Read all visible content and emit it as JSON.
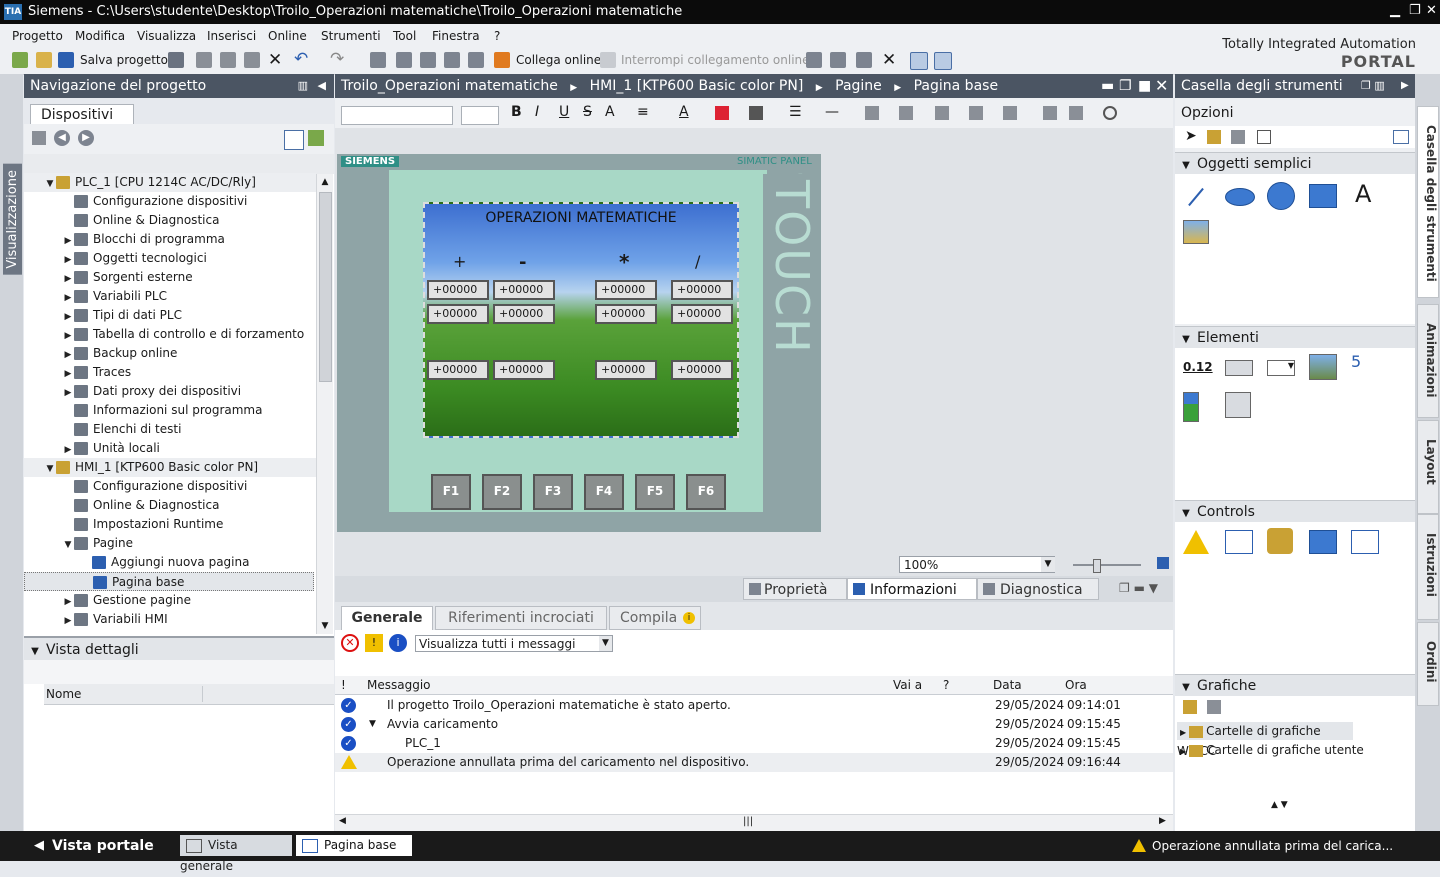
{
  "window": {
    "app": "Siemens",
    "path": "C:\\Users\\studente\\Desktop\\Troilo_Operazioni matematiche\\Troilo_Operazioni matematiche"
  },
  "menu": [
    "Progetto",
    "Modifica",
    "Visualizza",
    "Inserisci",
    "Online",
    "Strumenti",
    "Tool",
    "Finestra",
    "?"
  ],
  "toolbar": {
    "save": "Salva progetto",
    "connect": "Collega online",
    "disconnect": "Interrompi collegamento online"
  },
  "brand": {
    "line1": "Totally Integrated Automation",
    "line2": "PORTAL"
  },
  "left": {
    "title": "Navigazione del progetto",
    "tab": "Dispositivi",
    "strip": "Visualizzazione",
    "tree": [
      {
        "label": "PLC_1 [CPU 1214C AC/DC/Rly]",
        "arrow": "▼",
        "level": 0
      },
      {
        "label": "Configurazione dispositivi",
        "arrow": "",
        "level": 1
      },
      {
        "label": "Online & Diagnostica",
        "arrow": "",
        "level": 1
      },
      {
        "label": "Blocchi di programma",
        "arrow": "▶",
        "level": 1
      },
      {
        "label": "Oggetti tecnologici",
        "arrow": "▶",
        "level": 1
      },
      {
        "label": "Sorgenti esterne",
        "arrow": "▶",
        "level": 1
      },
      {
        "label": "Variabili PLC",
        "arrow": "▶",
        "level": 1
      },
      {
        "label": "Tipi di dati PLC",
        "arrow": "▶",
        "level": 1
      },
      {
        "label": "Tabella di controllo e di forzamento",
        "arrow": "▶",
        "level": 1
      },
      {
        "label": "Backup online",
        "arrow": "▶",
        "level": 1
      },
      {
        "label": "Traces",
        "arrow": "▶",
        "level": 1
      },
      {
        "label": "Dati proxy dei dispositivi",
        "arrow": "▶",
        "level": 1
      },
      {
        "label": "Informazioni sul programma",
        "arrow": "",
        "level": 1
      },
      {
        "label": "Elenchi di testi",
        "arrow": "",
        "level": 1
      },
      {
        "label": "Unità locali",
        "arrow": "▶",
        "level": 1
      },
      {
        "label": "HMI_1 [KTP600 Basic color PN]",
        "arrow": "▼",
        "level": 0
      },
      {
        "label": "Configurazione dispositivi",
        "arrow": "",
        "level": 1
      },
      {
        "label": "Online & Diagnostica",
        "arrow": "",
        "level": 1
      },
      {
        "label": "Impostazioni Runtime",
        "arrow": "",
        "level": 1
      },
      {
        "label": "Pagine",
        "arrow": "▼",
        "level": 1
      },
      {
        "label": "Aggiungi nuova pagina",
        "arrow": "",
        "level": 2
      },
      {
        "label": "Pagina base",
        "arrow": "",
        "level": 2
      },
      {
        "label": "Gestione pagine",
        "arrow": "▶",
        "level": 1
      },
      {
        "label": "Variabili HMI",
        "arrow": "▶",
        "level": 1
      }
    ],
    "details_title": "Vista dettagli",
    "details_col": "Nome"
  },
  "editor": {
    "breadcrumb": [
      "Troilo_Operazioni matematiche",
      "HMI_1 [KTP600 Basic color PN]",
      "Pagine",
      "Pagina base"
    ],
    "brand": "SIEMENS",
    "panel_label": "SIMATIC PANEL",
    "touch": "TOUCH",
    "screen_title": "OPERAZIONI MATEMATICHE",
    "ops": [
      "+",
      "-",
      "*",
      "/"
    ],
    "field_value": "+00000",
    "fkeys": [
      "F1",
      "F2",
      "F3",
      "F4",
      "F5",
      "F6"
    ],
    "zoom": "100%"
  },
  "info": {
    "top_tabs": [
      "Proprietà",
      "Informazioni",
      "Diagnostica"
    ],
    "tabs": [
      "Generale",
      "Riferimenti incrociati",
      "Compila"
    ],
    "filter": "Visualizza tutti i messaggi",
    "columns": [
      "!",
      "Messaggio",
      "Vai a",
      "?",
      "Data",
      "Ora"
    ],
    "rows": [
      {
        "msg": "Il progetto Troilo_Operazioni matematiche è stato aperto.",
        "date": "29/05/2024",
        "time": "09:14:01",
        "icon": "ok"
      },
      {
        "msg": "Avvia caricamento",
        "date": "29/05/2024",
        "time": "09:15:45",
        "icon": "ok"
      },
      {
        "msg": "PLC_1",
        "date": "29/05/2024",
        "time": "09:15:45",
        "icon": "ok"
      },
      {
        "msg": "Operazione annullata prima del caricamento nel dispositivo.",
        "date": "29/05/2024",
        "time": "09:16:44",
        "icon": "warn"
      }
    ]
  },
  "right": {
    "title": "Casella degli strumenti",
    "options": "Opzioni",
    "sections": [
      "Oggetti semplici",
      "Elementi",
      "Controls",
      "Grafiche"
    ],
    "graphics": [
      "Cartelle di grafiche WinCC",
      "Cartelle di grafiche utente"
    ],
    "strip": [
      "Casella degli strumenti",
      "Animazioni",
      "Layout",
      "Istruzioni",
      "Ordini"
    ],
    "clock_digit": "5",
    "io_label": "0.12"
  },
  "status": {
    "portal": "Vista portale",
    "tabs": [
      "Vista generale",
      "Pagina base"
    ],
    "msg": "Operazione annullata prima del carica..."
  }
}
